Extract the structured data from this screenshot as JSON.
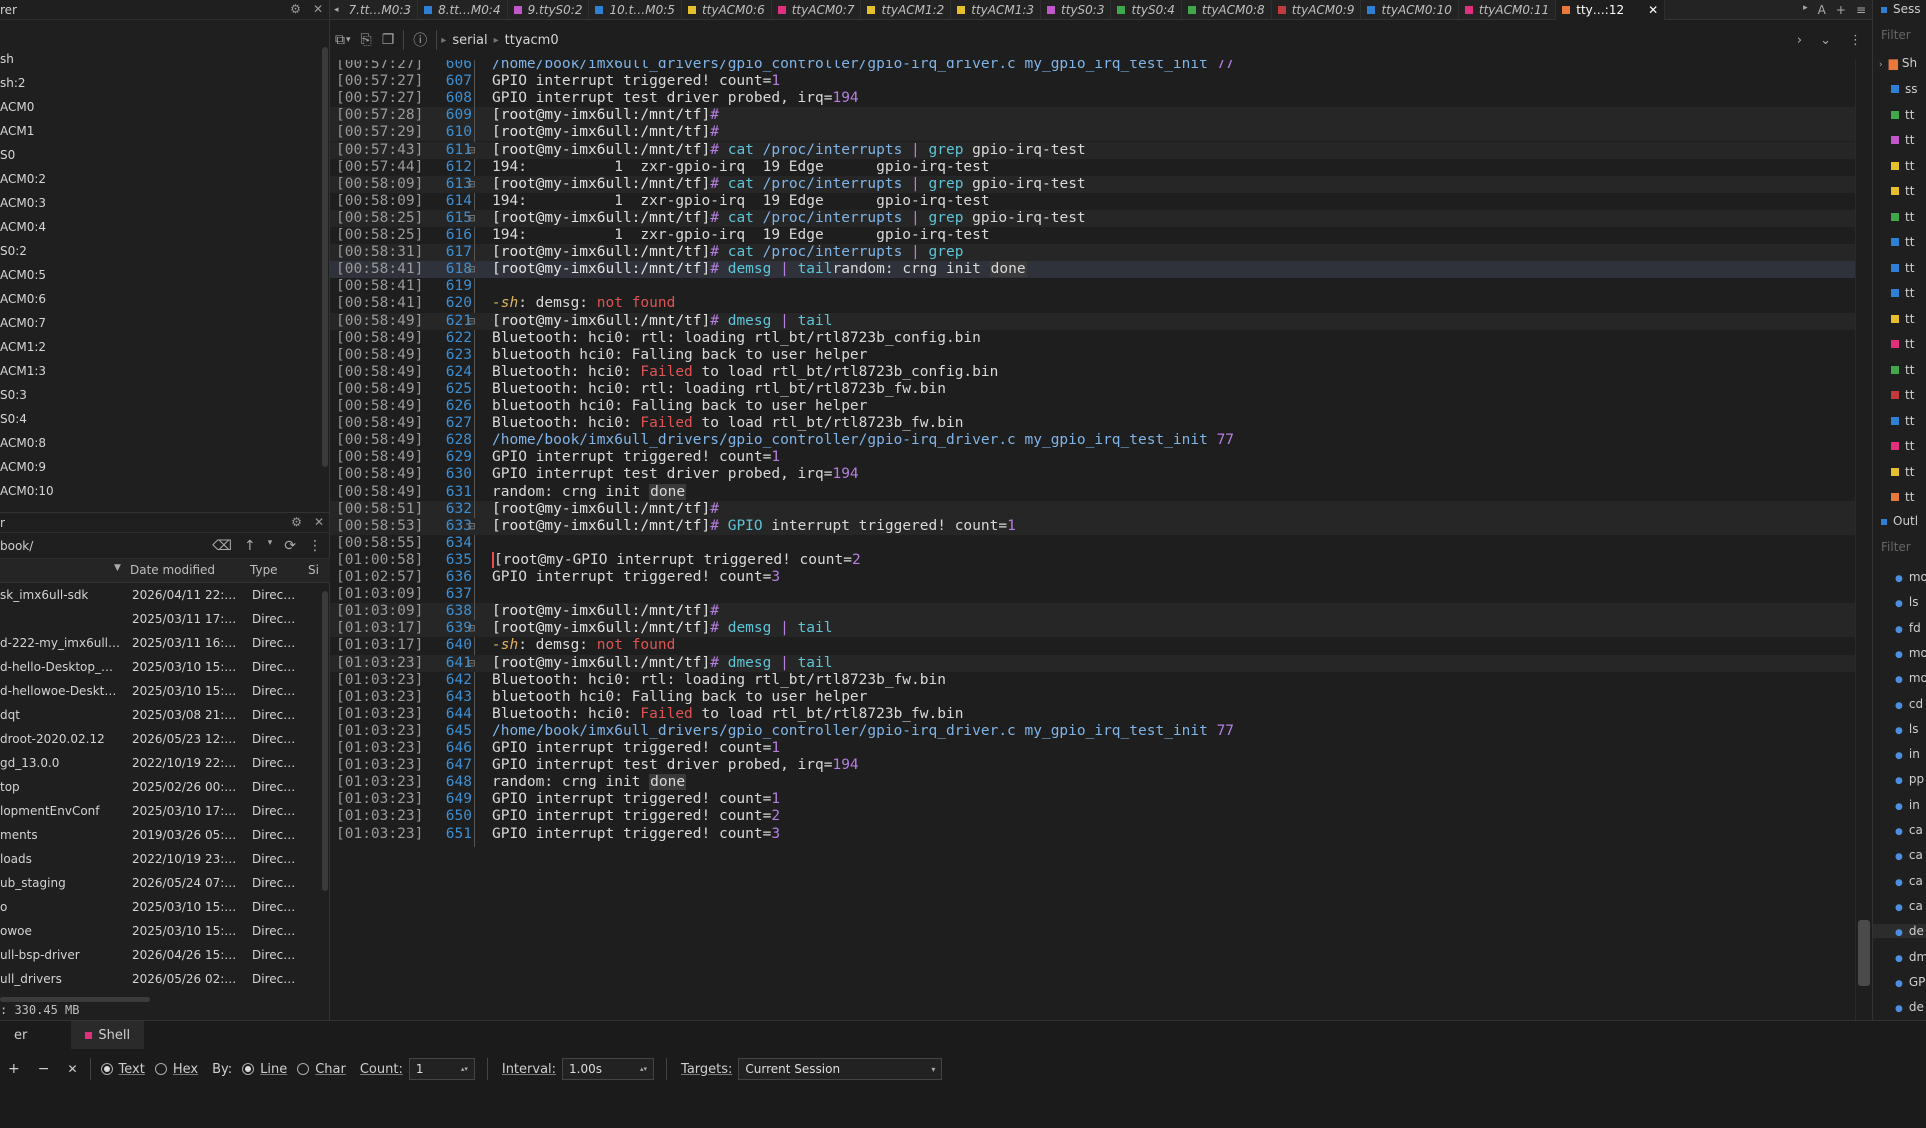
{
  "left_panel": {
    "sessions_title": "rer",
    "sessions": [
      "sh",
      "sh:2",
      "ACM0",
      "ACM1",
      "S0",
      "ACM0:2",
      "ACM0:3",
      "ACM0:4",
      "S0:2",
      "ACM0:5",
      "ACM0:6",
      "ACM0:7",
      "ACM1:2",
      "ACM1:3",
      "S0:3",
      "S0:4",
      "ACM0:8",
      "ACM0:9",
      "ACM0:10"
    ],
    "files_title": "r",
    "path": "book/",
    "columns": [
      "Date modified",
      "Type",
      "Si"
    ],
    "files": [
      {
        "name": "sk_imx6ull-sdk",
        "date": "2026/04/11 22:…",
        "type": "Direc…"
      },
      {
        "name": "",
        "date": "2025/03/11 17:…",
        "type": "Direc…"
      },
      {
        "name": "d-222-my_imx6ull…",
        "date": "2025/03/11 16:…",
        "type": "Direc…"
      },
      {
        "name": "d-hello-Desktop_…",
        "date": "2025/03/10 15:…",
        "type": "Direc…"
      },
      {
        "name": "d-hellowoe-Deskt…",
        "date": "2025/03/10 15:…",
        "type": "Direc…"
      },
      {
        "name": "dqt",
        "date": "2025/03/08 21:…",
        "type": "Direc…"
      },
      {
        "name": "droot-2020.02.12",
        "date": "2026/05/23 12:…",
        "type": "Direc…"
      },
      {
        "name": "gd_13.0.0",
        "date": "2022/10/19 22:…",
        "type": "Direc…"
      },
      {
        "name": "top",
        "date": "2025/02/26 00:…",
        "type": "Direc…"
      },
      {
        "name": "lopmentEnvConf",
        "date": "2025/03/10 17:…",
        "type": "Direc…"
      },
      {
        "name": "ments",
        "date": "2019/03/26 05:…",
        "type": "Direc…"
      },
      {
        "name": "loads",
        "date": "2022/10/19 23:…",
        "type": "Direc…"
      },
      {
        "name": "ub_staging",
        "date": "2026/05/24 07:…",
        "type": "Direc…"
      },
      {
        "name": "o",
        "date": "2025/03/10 15:…",
        "type": "Direc…"
      },
      {
        "name": "owoe",
        "date": "2025/03/10 15:…",
        "type": "Direc…"
      },
      {
        "name": "ull-bsp-driver",
        "date": "2026/04/26 15:…",
        "type": "Direc…"
      },
      {
        "name": "ull_drivers",
        "date": "2026/05/26 02:…",
        "type": "Direc…"
      }
    ],
    "status": ": 330.45 MB"
  },
  "tabs": [
    {
      "label": "7.tt…M0:3",
      "color": ""
    },
    {
      "label": "8.tt…M0:4",
      "color": "#2f7fd6"
    },
    {
      "label": "9.ttyS0:2",
      "color": "#c157c9"
    },
    {
      "label": "10.t…M0:5",
      "color": "#2f7fd6"
    },
    {
      "label": "ttyACM0:6",
      "color": "#e6c02c"
    },
    {
      "label": "ttyACM0:7",
      "color": "#e0307d"
    },
    {
      "label": "ttyACM1:2",
      "color": "#e6c02c"
    },
    {
      "label": "ttyACM1:3",
      "color": "#e6c02c"
    },
    {
      "label": "ttyS0:3",
      "color": "#c157c9"
    },
    {
      "label": "ttyS0:4",
      "color": "#3ea84a"
    },
    {
      "label": "ttyACM0:8",
      "color": "#3ea84a"
    },
    {
      "label": "ttyACM0:9",
      "color": "#c23a3a"
    },
    {
      "label": "ttyACM0:10",
      "color": "#2f7fd6"
    },
    {
      "label": "ttyACM0:11",
      "color": "#e0307d"
    },
    {
      "label": "tty…:12",
      "color": "#e8793a",
      "active": true
    }
  ],
  "tab_controls": [
    "A",
    "+",
    "≡"
  ],
  "toolbar": {
    "crumbs": [
      "serial",
      "ttyacm0"
    ]
  },
  "terminal": [
    {
      "ts": "[00:57:27]",
      "ln": "606",
      "parts": [
        [
          "path",
          "/home/book/imx6ull_drivers/gpio_controller/gpio-irq_driver.c my_gpio_irq_test_init "
        ],
        [
          "num",
          "77"
        ]
      ]
    },
    {
      "ts": "[00:57:27]",
      "ln": "607",
      "parts": [
        [
          "",
          "GPIO interrupt triggered! count="
        ],
        [
          "num",
          "1"
        ]
      ]
    },
    {
      "ts": "[00:57:27]",
      "ln": "608",
      "parts": [
        [
          "",
          "GPIO interrupt test driver probed, irq="
        ],
        [
          "num",
          "194"
        ]
      ]
    },
    {
      "ts": "[00:57:28]",
      "ln": "609",
      "hl": true,
      "parts": [
        [
          "prompt",
          "[root@my-imx6ull:/mnt/tf]"
        ],
        [
          "num",
          "#"
        ]
      ]
    },
    {
      "ts": "[00:57:29]",
      "ln": "610",
      "hl": true,
      "parts": [
        [
          "prompt",
          "[root@my-imx6ull:/mnt/tf]"
        ],
        [
          "num",
          "#"
        ]
      ]
    },
    {
      "ts": "[00:57:43]",
      "ln": "611",
      "fold": true,
      "hl": true,
      "parts": [
        [
          "prompt",
          "[root@my-imx6ull:/mnt/tf]"
        ],
        [
          "num",
          "# "
        ],
        [
          "cmd",
          "cat "
        ],
        [
          "path",
          "/proc/interrupts "
        ],
        [
          "num",
          "| "
        ],
        [
          "cmd",
          "grep "
        ],
        [
          "",
          "gpio-irq-test"
        ]
      ]
    },
    {
      "ts": "[00:57:44]",
      "ln": "612",
      "parts": [
        [
          "",
          "194:          1  zxr-gpio-irq  19 Edge      gpio-irq-test"
        ]
      ]
    },
    {
      "ts": "[00:58:09]",
      "ln": "613",
      "fold": true,
      "hl": true,
      "parts": [
        [
          "prompt",
          "[root@my-imx6ull:/mnt/tf]"
        ],
        [
          "num",
          "# "
        ],
        [
          "cmd",
          "cat "
        ],
        [
          "path",
          "/proc/interrupts "
        ],
        [
          "num",
          "| "
        ],
        [
          "cmd",
          "grep "
        ],
        [
          "",
          "gpio-irq-test"
        ]
      ]
    },
    {
      "ts": "[00:58:09]",
      "ln": "614",
      "parts": [
        [
          "",
          "194:          1  zxr-gpio-irq  19 Edge      gpio-irq-test"
        ]
      ]
    },
    {
      "ts": "[00:58:25]",
      "ln": "615",
      "fold": true,
      "hl": true,
      "parts": [
        [
          "prompt",
          "[root@my-imx6ull:/mnt/tf]"
        ],
        [
          "num",
          "# "
        ],
        [
          "cmd",
          "cat "
        ],
        [
          "path",
          "/proc/interrupts "
        ],
        [
          "num",
          "| "
        ],
        [
          "cmd",
          "grep "
        ],
        [
          "",
          "gpio-irq-test"
        ]
      ]
    },
    {
      "ts": "[00:58:25]",
      "ln": "616",
      "parts": [
        [
          "",
          "194:          1  zxr-gpio-irq  19 Edge      gpio-irq-test"
        ]
      ]
    },
    {
      "ts": "[00:58:31]",
      "ln": "617",
      "hl": true,
      "parts": [
        [
          "prompt",
          "[root@my-imx6ull:/mnt/tf]"
        ],
        [
          "num",
          "# "
        ],
        [
          "cmd",
          "cat "
        ],
        [
          "path",
          "/proc/interrupts "
        ],
        [
          "num",
          "| "
        ],
        [
          "cmd",
          "grep"
        ]
      ]
    },
    {
      "ts": "[00:58:41]",
      "ln": "618",
      "fold": true,
      "sel": true,
      "parts": [
        [
          "prompt",
          "[root@my-imx6ull:/mnt/tf]"
        ],
        [
          "num",
          "# "
        ],
        [
          "cmd",
          "demsg "
        ],
        [
          "num",
          "| "
        ],
        [
          "cmd",
          "tail"
        ],
        [
          "",
          "random: crng init "
        ],
        [
          "done",
          "done"
        ]
      ]
    },
    {
      "ts": "[00:58:41]",
      "ln": "619",
      "parts": []
    },
    {
      "ts": "[00:58:41]",
      "ln": "620",
      "parts": [
        [
          "it",
          "-sh"
        ],
        [
          "",
          ": demsg: "
        ],
        [
          "err",
          "not found"
        ]
      ]
    },
    {
      "ts": "[00:58:49]",
      "ln": "621",
      "fold": true,
      "hl": true,
      "parts": [
        [
          "prompt",
          "[root@my-imx6ull:/mnt/tf]"
        ],
        [
          "num",
          "# "
        ],
        [
          "cmd",
          "dmesg "
        ],
        [
          "num",
          "| "
        ],
        [
          "cmd",
          "tail"
        ]
      ]
    },
    {
      "ts": "[00:58:49]",
      "ln": "622",
      "parts": [
        [
          "",
          "Bluetooth: hci0: rtl: loading rtl_bt/rtl8723b_config.bin"
        ]
      ]
    },
    {
      "ts": "[00:58:49]",
      "ln": "623",
      "parts": [
        [
          "",
          "bluetooth hci0: Falling back to user helper"
        ]
      ]
    },
    {
      "ts": "[00:58:49]",
      "ln": "624",
      "parts": [
        [
          "",
          "Bluetooth: hci0: "
        ],
        [
          "err",
          "Failed"
        ],
        [
          "",
          " to load rtl_bt/rtl8723b_config.bin"
        ]
      ]
    },
    {
      "ts": "[00:58:49]",
      "ln": "625",
      "parts": [
        [
          "",
          "Bluetooth: hci0: rtl: loading rtl_bt/rtl8723b_fw.bin"
        ]
      ]
    },
    {
      "ts": "[00:58:49]",
      "ln": "626",
      "parts": [
        [
          "",
          "bluetooth hci0: Falling back to user helper"
        ]
      ]
    },
    {
      "ts": "[00:58:49]",
      "ln": "627",
      "parts": [
        [
          "",
          "Bluetooth: hci0: "
        ],
        [
          "err",
          "Failed"
        ],
        [
          "",
          " to load rtl_bt/rtl8723b_fw.bin"
        ]
      ]
    },
    {
      "ts": "[00:58:49]",
      "ln": "628",
      "parts": [
        [
          "path",
          "/home/book/imx6ull_drivers/gpio_controller/gpio-irq_driver.c my_gpio_irq_test_init "
        ],
        [
          "num",
          "77"
        ]
      ]
    },
    {
      "ts": "[00:58:49]",
      "ln": "629",
      "parts": [
        [
          "",
          "GPIO interrupt triggered! count="
        ],
        [
          "num",
          "1"
        ]
      ]
    },
    {
      "ts": "[00:58:49]",
      "ln": "630",
      "parts": [
        [
          "",
          "GPIO interrupt test driver probed, irq="
        ],
        [
          "num",
          "194"
        ]
      ]
    },
    {
      "ts": "[00:58:49]",
      "ln": "631",
      "parts": [
        [
          "",
          "random: crng init "
        ],
        [
          "done",
          "done"
        ]
      ]
    },
    {
      "ts": "[00:58:51]",
      "ln": "632",
      "hl": true,
      "parts": [
        [
          "prompt",
          "[root@my-imx6ull:/mnt/tf]"
        ],
        [
          "num",
          "#"
        ]
      ]
    },
    {
      "ts": "[00:58:53]",
      "ln": "633",
      "fold": true,
      "hl": true,
      "parts": [
        [
          "prompt",
          "[root@my-imx6ull:/mnt/tf]"
        ],
        [
          "num",
          "# "
        ],
        [
          "cmd",
          "GPIO "
        ],
        [
          "",
          "interrupt triggered! count="
        ],
        [
          "num",
          "1"
        ]
      ]
    },
    {
      "ts": "[00:58:55]",
      "ln": "634",
      "parts": []
    },
    {
      "ts": "[01:00:58]",
      "ln": "635",
      "parts": [
        [
          "cursor",
          "["
        ],
        [
          "",
          "root@my-GPIO interrupt triggered! count="
        ],
        [
          "num",
          "2"
        ]
      ]
    },
    {
      "ts": "[01:02:57]",
      "ln": "636",
      "parts": [
        [
          "",
          "GPIO interrupt triggered! count="
        ],
        [
          "num",
          "3"
        ]
      ]
    },
    {
      "ts": "[01:03:09]",
      "ln": "637",
      "parts": []
    },
    {
      "ts": "[01:03:09]",
      "ln": "638",
      "hl": true,
      "parts": [
        [
          "prompt",
          "[root@my-imx6ull:/mnt/tf]"
        ],
        [
          "num",
          "#"
        ]
      ]
    },
    {
      "ts": "[01:03:17]",
      "ln": "639",
      "fold": true,
      "hl": true,
      "parts": [
        [
          "prompt",
          "[root@my-imx6ull:/mnt/tf]"
        ],
        [
          "num",
          "# "
        ],
        [
          "cmd",
          "demsg "
        ],
        [
          "num",
          "| "
        ],
        [
          "cmd",
          "tail"
        ]
      ]
    },
    {
      "ts": "[01:03:17]",
      "ln": "640",
      "parts": [
        [
          "it",
          "-sh"
        ],
        [
          "",
          ": demsg: "
        ],
        [
          "err",
          "not found"
        ]
      ]
    },
    {
      "ts": "[01:03:23]",
      "ln": "641",
      "fold": true,
      "hl": true,
      "parts": [
        [
          "prompt",
          "[root@my-imx6ull:/mnt/tf]"
        ],
        [
          "num",
          "# "
        ],
        [
          "cmd",
          "dmesg "
        ],
        [
          "num",
          "| "
        ],
        [
          "cmd",
          "tail"
        ]
      ]
    },
    {
      "ts": "[01:03:23]",
      "ln": "642",
      "parts": [
        [
          "",
          "Bluetooth: hci0: rtl: loading rtl_bt/rtl8723b_fw.bin"
        ]
      ]
    },
    {
      "ts": "[01:03:23]",
      "ln": "643",
      "parts": [
        [
          "",
          "bluetooth hci0: Falling back to user helper"
        ]
      ]
    },
    {
      "ts": "[01:03:23]",
      "ln": "644",
      "parts": [
        [
          "",
          "Bluetooth: hci0: "
        ],
        [
          "err",
          "Failed"
        ],
        [
          "",
          " to load rtl_bt/rtl8723b_fw.bin"
        ]
      ]
    },
    {
      "ts": "[01:03:23]",
      "ln": "645",
      "parts": [
        [
          "path",
          "/home/book/imx6ull_drivers/gpio_controller/gpio-irq_driver.c my_gpio_irq_test_init "
        ],
        [
          "num",
          "77"
        ]
      ]
    },
    {
      "ts": "[01:03:23]",
      "ln": "646",
      "parts": [
        [
          "",
          "GPIO interrupt triggered! count="
        ],
        [
          "num",
          "1"
        ]
      ]
    },
    {
      "ts": "[01:03:23]",
      "ln": "647",
      "parts": [
        [
          "",
          "GPIO interrupt test driver probed, irq="
        ],
        [
          "num",
          "194"
        ]
      ]
    },
    {
      "ts": "[01:03:23]",
      "ln": "648",
      "parts": [
        [
          "",
          "random: crng init "
        ],
        [
          "done",
          "done"
        ]
      ]
    },
    {
      "ts": "[01:03:23]",
      "ln": "649",
      "parts": [
        [
          "",
          "GPIO interrupt triggered! count="
        ],
        [
          "num",
          "1"
        ]
      ]
    },
    {
      "ts": "[01:03:23]",
      "ln": "650",
      "parts": [
        [
          "",
          "GPIO interrupt triggered! count="
        ],
        [
          "num",
          "2"
        ]
      ]
    },
    {
      "ts": "[01:03:23]",
      "ln": "651",
      "parts": [
        [
          "",
          "GPIO interrupt triggered! count="
        ],
        [
          "num",
          "3"
        ]
      ]
    }
  ],
  "right_panel": {
    "title": "Sess",
    "filter_placeholder": "Filter",
    "tree_root": "Sh",
    "items": [
      {
        "label": "ss",
        "color": "#2f7fd6"
      },
      {
        "label": "tt",
        "color": "#3ea84a"
      },
      {
        "label": "tt",
        "color": "#c157c9"
      },
      {
        "label": "tt",
        "color": "#e6c02c"
      },
      {
        "label": "tt",
        "color": "#e6c02c"
      },
      {
        "label": "tt",
        "color": "#3ea84a"
      },
      {
        "label": "tt",
        "color": "#2f7fd6"
      },
      {
        "label": "tt",
        "color": "#2f7fd6"
      },
      {
        "label": "tt",
        "color": "#2f7fd6"
      },
      {
        "label": "tt",
        "color": "#e6c02c"
      },
      {
        "label": "tt",
        "color": "#e0307d"
      },
      {
        "label": "tt",
        "color": "#3ea84a"
      },
      {
        "label": "tt",
        "color": "#c23a3a"
      },
      {
        "label": "tt",
        "color": "#2f7fd6"
      },
      {
        "label": "tt",
        "color": "#e0307d"
      },
      {
        "label": "tt",
        "color": "#e6c02c"
      },
      {
        "label": "tt",
        "color": "#e8793a"
      }
    ],
    "outline_title": "Outl",
    "outline_filter": "Filter",
    "outline": [
      "mo",
      "ls",
      "fd",
      "mo",
      "mo",
      "cd",
      "ls",
      "in",
      "pp",
      "in",
      "ca",
      "ca",
      "ca",
      "ca",
      "de",
      "dm",
      "GP",
      "de"
    ]
  },
  "bottom": {
    "tabs": [
      {
        "label": "er"
      },
      {
        "label": "Shell",
        "active": true
      }
    ],
    "text_label": "Text",
    "hex_label": "Hex",
    "by_label": "By:",
    "line_label": "Line",
    "char_label": "Char",
    "count_label": "Count:",
    "count_value": "1",
    "interval_label": "Interval:",
    "interval_value": "1.00s",
    "targets_label": "Targets:",
    "targets_value": "Current Session"
  }
}
